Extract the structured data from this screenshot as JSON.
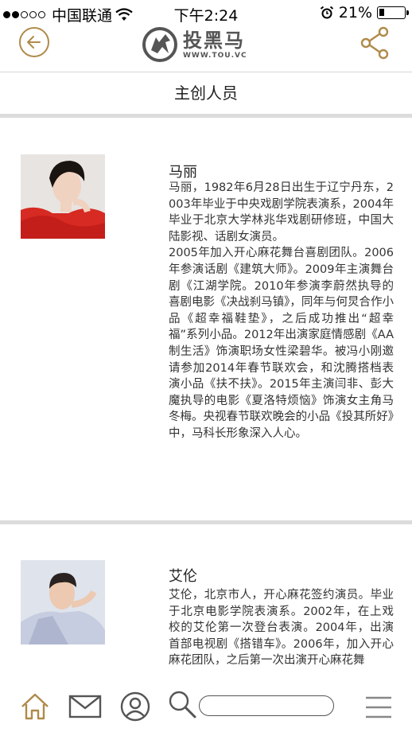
{
  "status_bar": {
    "carrier": "中国联通",
    "time": "下午2:24",
    "battery_percent": "21%",
    "battery_level": 0.21
  },
  "header": {
    "logo_text": "投黑马",
    "logo_url_text": "WWW.TOU.VC",
    "back_icon": "back-arrow-icon",
    "share_icon": "share-icon"
  },
  "page": {
    "title": "主创人员"
  },
  "people": [
    {
      "name": "马丽",
      "bio": "马丽，1982年6月28日出生于辽宁丹东，2003年毕业于中央戏剧学院表演系，2004年毕业于北京大学林兆华戏剧研修班，中国大陆影视、话剧女演员。\n2005年加入开心麻花舞台喜剧团队。2006年参演话剧《建筑大师》。2009年主演舞台剧《江湖学院。2010年参演李蔚然执导的喜剧电影《决战刹马镇》，同年与何炅合作小品《超幸福鞋垫》，之后成功推出“超幸福”系列小品。2012年出演家庭情感剧《AA制生活》饰演职场女性梁碧华。被冯小刚邀请参加2014年春节联欢会，和沈腾搭档表演小品《扶不扶》。2015年主演闫非、彭大魔执导的电影《夏洛特烦恼》饰演女主角马冬梅。央视春节联欢晚会的小品《投其所好》中，马科长形象深入人心。"
    },
    {
      "name": "艾伦",
      "bio": "艾伦，北京市人，开心麻花签约演员。毕业于北京电影学院表演系。2002年，在上戏校的艾伦第一次登台表演。2004年，出演首部电视剧《搭错车》。2006年，加入开心麻花团队，之后第一次出演开心麻花舞"
    }
  ],
  "bottom_bar": {
    "icons": [
      "home-icon",
      "mail-icon",
      "user-icon",
      "search-icon",
      "menu-icon"
    ],
    "accent_color": "#b08a4a"
  },
  "colors": {
    "accent": "#b08a4a",
    "divider": "#dcdcdc"
  }
}
